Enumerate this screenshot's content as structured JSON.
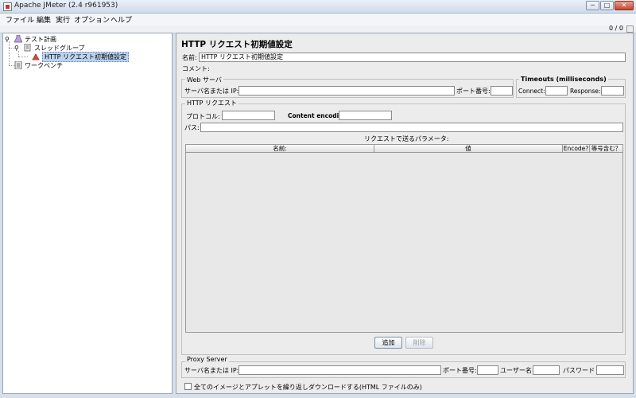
{
  "window": {
    "title": "Apache JMeter (2.4 r961953)",
    "minimize": "─",
    "maximize": "□",
    "close": "✕"
  },
  "menubar": [
    "ファイル",
    "編集",
    "実行",
    "オプション",
    "ヘルプ"
  ],
  "toolbar": {
    "counter": "0 / 0"
  },
  "tree": {
    "items": [
      {
        "label": "テスト計画",
        "icon": "test-plan-icon"
      },
      {
        "label": "スレッドグループ",
        "icon": "thread-group-icon"
      },
      {
        "label": "HTTP リクエスト初期値設定",
        "icon": "config-element-icon",
        "selected": true
      },
      {
        "label": "ワークベンチ",
        "icon": "workbench-icon"
      }
    ]
  },
  "panel": {
    "title": "HTTP リクエスト初期値設定",
    "name_label": "名前:",
    "name_value": "HTTP リクエスト初期値設定",
    "comment_label": "コメント:",
    "web_server": {
      "title": "Web サーバ",
      "server_label": "サーバ名または IP:",
      "server_value": "",
      "port_label": "ポート番号:",
      "port_value": ""
    },
    "timeouts": {
      "title": "Timeouts (milliseconds)",
      "connect_label": "Connect:",
      "connect_value": "",
      "response_label": "Response:",
      "response_value": ""
    },
    "http_request": {
      "title": "HTTP リクエスト",
      "protocol_label": "プロトコル:",
      "protocol_value": "",
      "encoding_label": "Content encoding:",
      "encoding_value": "",
      "path_label": "パス:",
      "path_value": "",
      "params_title": "リクエストで送るパラメータ:",
      "columns": [
        "名前:",
        "値",
        "Encode?",
        "等号含む？"
      ],
      "add_button": "追加",
      "delete_button": "削除"
    },
    "proxy": {
      "title": "Proxy Server",
      "server_label": "サーバ名または IP:",
      "port_label": "ポート番号:",
      "user_label": "ユーザー名",
      "password_label": "パスワード"
    },
    "download_checkbox": "全てのイメージとアプレットを繰り返しダウンロードする(HTML ファイルのみ)"
  }
}
